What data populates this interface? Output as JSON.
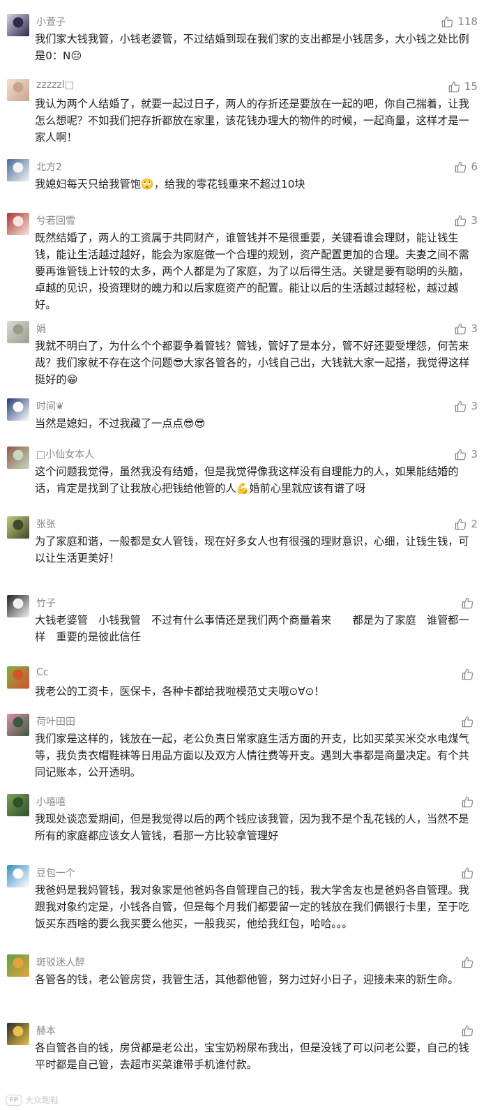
{
  "colors": {
    "name": "#888888",
    "text": "#222222",
    "like_icon": "#8a8a8a",
    "watermark": "#c9c9c9"
  },
  "comments": [
    {
      "name": "小萱子",
      "likes": "118",
      "avatar_icon": "cartoon-avatar-icon",
      "avatar_colors": [
        "#2d2a4a",
        "#d8d0e8"
      ],
      "text": "我们家大钱我管，小钱老婆管，不过结婚到现在我们家的支出都是小钱居多，大小钱之处比例是0：N😔"
    },
    {
      "name": "zzzzzl□",
      "likes": "15",
      "avatar_icon": "girl-photo-avatar-icon",
      "avatar_colors": [
        "#c9a48b",
        "#f1dfd2"
      ],
      "text": "我认为两个人结婚了，就要一起过日子，两人的存折还是要放在一起的吧，你自己揣着，让我怎么想呢？不如我们把存折都放在家里，该花钱办理大的物件的时候，一起商量，这样才是一家人啊！"
    },
    {
      "name": "北方2",
      "likes": "6",
      "avatar_icon": "cartoon-avatar-icon",
      "avatar_colors": [
        "#f4f4f4",
        "#4a6b9a"
      ],
      "text": "我媳妇每天只给我管饱🙄，给我的零花钱重来不超过10块"
    },
    {
      "name": "兮若回雪",
      "likes": "3",
      "avatar_icon": "woman-photo-avatar-icon",
      "avatar_colors": [
        "#f2e6e0",
        "#b3322a"
      ],
      "text": "既然结婚了，两人的工资属于共同财产，谁管钱并不是很重要，关键看谁会理财，能让钱生钱，能让生活越过越好，能会为家庭做一个合理的规划，资产配置更加的合理。夫妻之间不需要再谁管钱上计较的太多，两个人都是为了家庭，为了以后得生活。关键是要有聪明的头脑，卓越的见识，投资理财的魄力和以后家庭资产的配置。能让以后的生活越过越轻松，越过越好。"
    },
    {
      "name": "娟",
      "likes": "3",
      "avatar_icon": "bead-bracelet-avatar-icon",
      "avatar_colors": [
        "#9a9c8e",
        "#dcdcd2"
      ],
      "text": "我就不明白了，为什么个个都要争着管钱？管钱，管好了是本分，管不好还要受埋怨，何苦来哉？我们家就不存在这个问题😎大家各管各的，小钱自己出，大钱就大家一起搭，我觉得这样挺好的😁"
    },
    {
      "name": "时间❦",
      "likes": "3",
      "avatar_icon": "figure-avatar-icon",
      "avatar_colors": [
        "#ffffff",
        "#1f3d7a"
      ],
      "text": "当然是媳妇，不过我藏了一点点😎😎"
    },
    {
      "name": "□小仙女本人",
      "likes": "3",
      "avatar_icon": "girl-photo-avatar-icon",
      "avatar_colors": [
        "#c7d8c0",
        "#8c5a45"
      ],
      "text": "这个问题我觉得，虽然我没有结婚，但是我觉得像我这样没有自理能力的人，如果能结婚的话，肯定是找到了让我放心把钱给他管的人💪婚前心里就应该有谱了呀"
    },
    {
      "name": "张张",
      "likes": "2",
      "avatar_icon": "landscape-avatar-icon",
      "avatar_colors": [
        "#3d4a2a",
        "#c4c77a"
      ],
      "text": "为了家庭和谐，一般都是女人管钱，现在好多女人也有很强的理财意识，心细，让钱生钱，可以让生活更美好！"
    },
    {
      "name": "竹子",
      "likes": "",
      "avatar_icon": "silhouette-avatar-icon",
      "avatar_colors": [
        "#f1f1f1",
        "#222222"
      ],
      "text": "大钱老婆管　小钱我管　不过有什么事情还是我们两个商量着来　　都是为了家庭　谁管都一样　重要的是彼此信任"
    },
    {
      "name": "Cc",
      "likes": "",
      "avatar_icon": "fruit-avatar-icon",
      "avatar_colors": [
        "#d9502f",
        "#7fb23a"
      ],
      "text": "我老公的工资卡，医保卡，各种卡都给我啦模范丈夫哦⊙∀⊙！"
    },
    {
      "name": "荷叶田田",
      "likes": "",
      "avatar_icon": "lotus-avatar-icon",
      "avatar_colors": [
        "#3b5a3a",
        "#d98fb0"
      ],
      "text": "我们家是这样的，钱放在一起，老公负责日常家庭生活方面的开支，比如买菜买米交水电煤气等，我负责衣帽鞋袜等日用品方面以及双方人情往费等开支。遇到大事都是商量决定。有个共同记账本，公开透明。"
    },
    {
      "name": "小嘻嘻",
      "likes": "",
      "avatar_icon": "landscape-avatar-icon",
      "avatar_colors": [
        "#2f4f2a",
        "#7aa05a"
      ],
      "text": "我现处谈恋爱期间，但是我觉得以后的两个钱应该我管，因为我不是个乱花钱的人，当然不是所有的家庭都应该女人管钱，看那一方比较拿管理好"
    },
    {
      "name": "豆包一个",
      "likes": "",
      "avatar_icon": "number-one-avatar-icon",
      "avatar_colors": [
        "#ffffff",
        "#3a8fc7"
      ],
      "text": "我爸妈是我妈管钱，我对象家是他爸妈各自管理自己的钱，我大学舍友也是爸妈各自管理。我跟我对象约定是，小钱各自管，但是每个月我们都要留一定的钱放在我们俩银行卡里，至于吃饭买东西啥的要么我买要么他买，一般我买，他给我红包，哈哈。。。"
    },
    {
      "name": "斑驳迷人醉",
      "likes": "",
      "avatar_icon": "food-avatar-icon",
      "avatar_colors": [
        "#e8a23a",
        "#5aa04a"
      ],
      "text": "各管各的钱，老公管房贷，我管生活，其他都他管，努力过好小日子，迎接未来的新生命。"
    },
    {
      "name": "赫本",
      "likes": "",
      "avatar_icon": "woman-photo-avatar-icon",
      "avatar_colors": [
        "#e9c24a",
        "#2b2b2b"
      ],
      "text": "各自管各自的钱，房贷都是老公出，宝宝奶粉尿布我出，但是没钱了可以问老公要，自己的钱平时都是自己管，去超市买菜谁带手机谁付款。"
    }
  ],
  "watermark": {
    "logo": "FP",
    "text": "大众跑鞋"
  }
}
